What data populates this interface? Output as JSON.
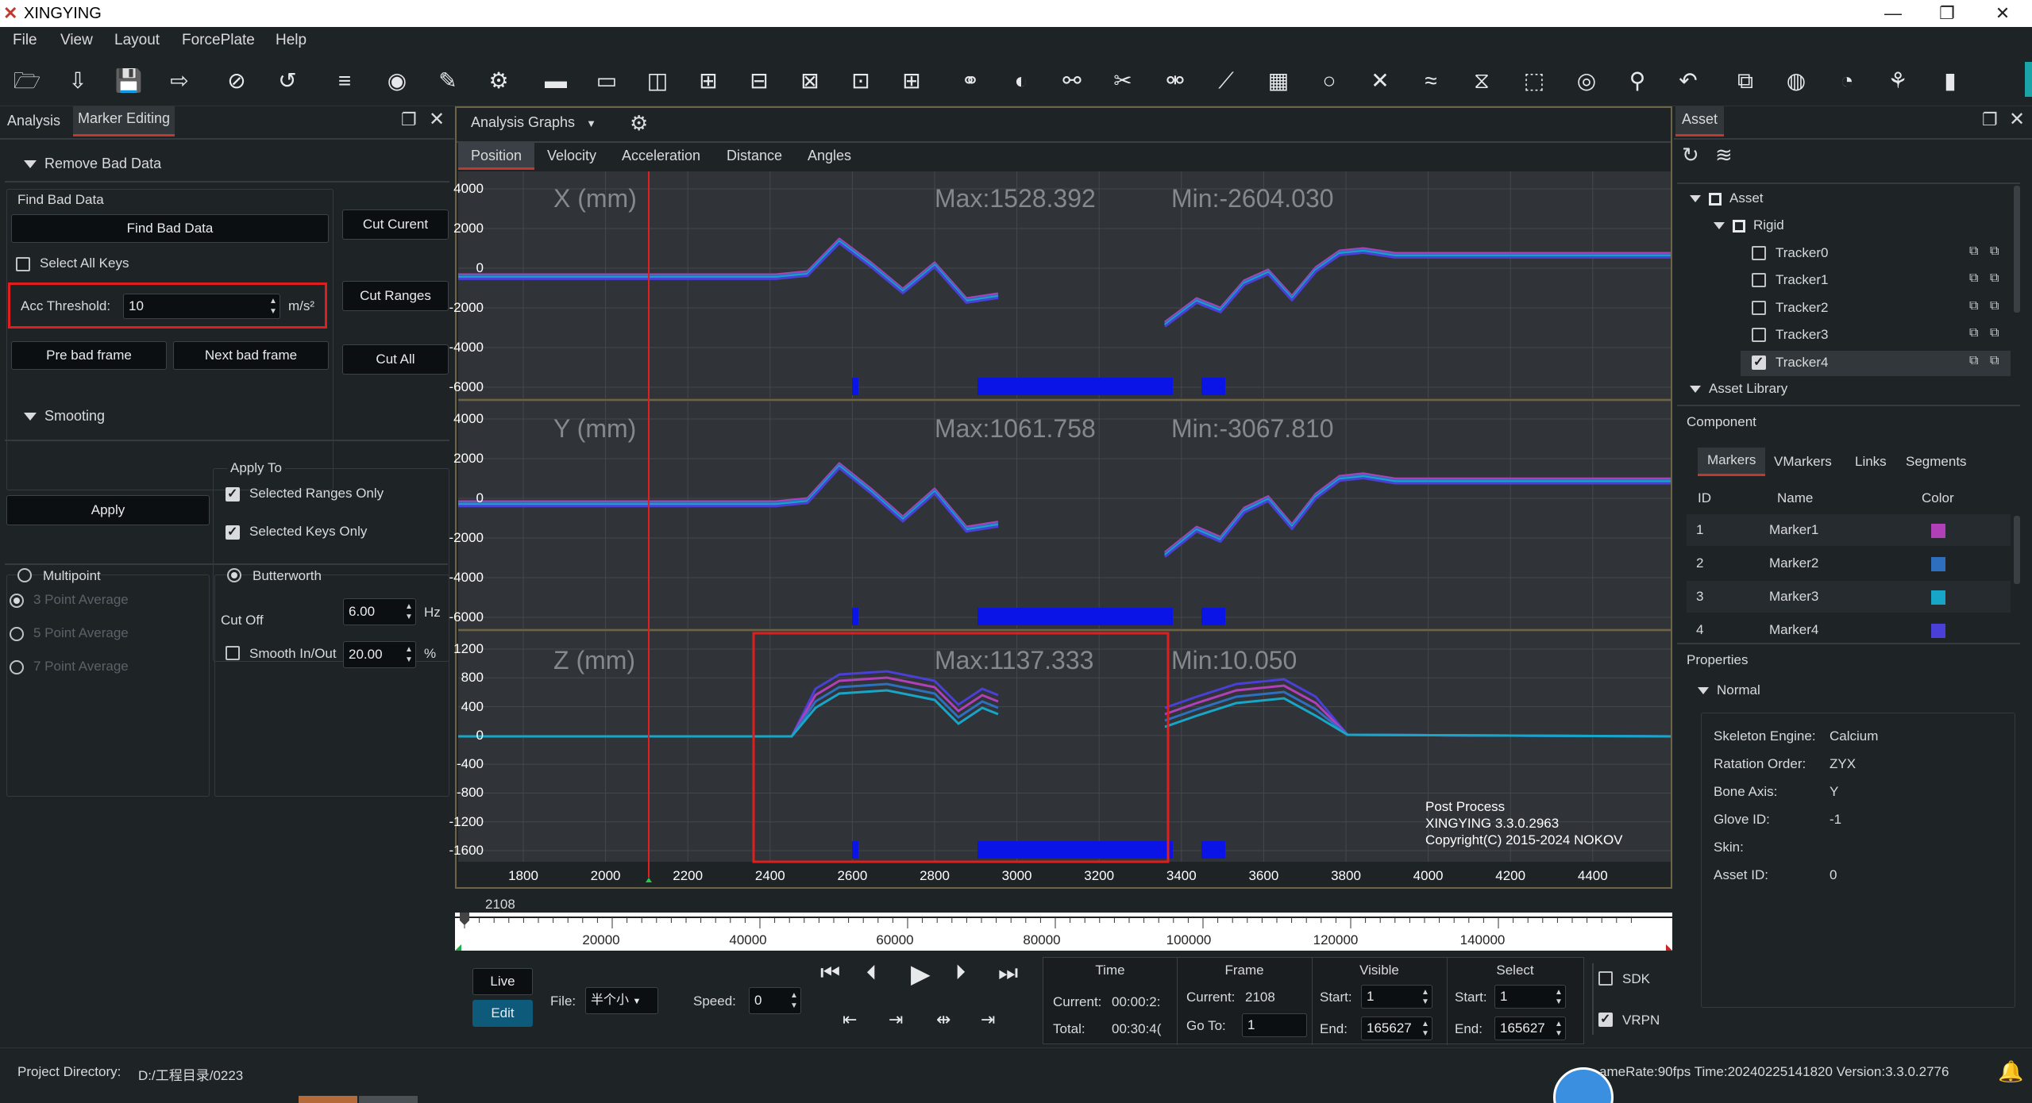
{
  "app": {
    "title": "XINGYING"
  },
  "window_controls": [
    "—",
    "❐",
    "✕"
  ],
  "menu": [
    "File",
    "View",
    "Layout",
    "ForcePlate",
    "Help"
  ],
  "toolbar_icons": [
    "open-folder-icon",
    "import-icon",
    "save-icon",
    "export-icon",
    "hide-icon",
    "rotate-icon",
    "layers-icon",
    "capture-icon",
    "edit-icon",
    "settings-icon",
    "layout-1-icon",
    "layout-2-icon",
    "layout-3-icon",
    "layout-4-icon",
    "layout-5-icon",
    "layout-6-icon",
    "layout-7-icon",
    "layout-8-icon",
    "link-icon",
    "fill-icon",
    "merge-icon",
    "cut-icon",
    "connect-icon",
    "bone-icon",
    "calculator-icon",
    "search-icon",
    "remove-icon",
    "smooth-icon",
    "trim-icon",
    "select-icon",
    "reset-icon",
    "run-icon",
    "undo-icon",
    "rigid-icon",
    "3d-icon",
    "speed-icon",
    "skeleton-icon",
    "chart-icon"
  ],
  "left": {
    "tabs": [
      "Analysis",
      "Marker Editing"
    ],
    "remove_bad_data": "Remove Bad Data",
    "find_bad_data": "Find Bad Data",
    "find_bad_data_btn": "Find Bad Data",
    "cut_current": "Cut Curent",
    "cut_ranges": "Cut Ranges",
    "cut_all": "Cut All",
    "select_all_keys": "Select All Keys",
    "acc_threshold_label": "Acc Threshold:",
    "acc_threshold_value": "10",
    "acc_unit": "m/s²",
    "pre_bad_frame": "Pre bad frame",
    "next_bad_frame": "Next bad frame",
    "smooting": "Smooting",
    "apply_to": "Apply To",
    "apply": "Apply",
    "selected_ranges_only": "Selected Ranges Only",
    "selected_keys_only": "Selected Keys Only",
    "multipoint": "Multipoint",
    "butterworth": "Butterworth",
    "avg3": "3 Point Average",
    "avg5": "5 Point Average",
    "avg7": "7 Point Average",
    "cutoff_label": "Cut Off",
    "cutoff_value": "6.00",
    "cutoff_unit": "Hz",
    "smooth_inout": "Smooth In/Out",
    "smooth_value": "20.00",
    "smooth_unit": "%"
  },
  "graphs": {
    "title": "Analysis Graphs",
    "tabs": [
      "Position",
      "Velocity",
      "Acceleration",
      "Distance",
      "Angles"
    ],
    "panels": [
      {
        "label": "X (mm)",
        "max": "Max:1528.392",
        "min": "Min:-2604.030",
        "yticks": [
          "4000",
          "2000",
          "0",
          "-2000",
          "-4000",
          "-6000"
        ]
      },
      {
        "label": "Y (mm)",
        "max": "Max:1061.758",
        "min": "Min:-3067.810",
        "yticks": [
          "4000",
          "2000",
          "0",
          "-2000",
          "-4000",
          "-6000"
        ]
      },
      {
        "label": "Z (mm)",
        "max": "Max:1137.333",
        "min": "Min:10.050",
        "yticks": [
          "1200",
          "800",
          "400",
          "0",
          "-400",
          "-800",
          "-1200",
          "-1600"
        ]
      }
    ],
    "xticks": [
      "1800",
      "2000",
      "2200",
      "2400",
      "2600",
      "2800",
      "3000",
      "3200",
      "3400",
      "3600",
      "3800",
      "4000",
      "4200",
      "4400"
    ],
    "watermark": [
      "Post Process",
      "XINGYING 3.3.0.2963",
      "Copyright(C) 2015-2024 NOKOV"
    ],
    "colors": {
      "marker1": "#b140b8",
      "marker2": "#2f6fc0",
      "marker3": "#18a6c8",
      "marker4": "#4a3fd6",
      "bad_data": "#0a14e6",
      "cursor": "#e02020"
    }
  },
  "timeline": {
    "current_frame": "2108",
    "ticks": [
      "20000",
      "40000",
      "60000",
      "80000",
      "100000",
      "120000",
      "140000"
    ]
  },
  "playback": {
    "live": "Live",
    "edit": "Edit",
    "file_label": "File:",
    "file_value": "半个小",
    "speed_label": "Speed:",
    "speed_value": "0",
    "time_header": "Time",
    "frame_header": "Frame",
    "visible_header": "Visible",
    "select_header": "Select",
    "current_label": "Current:",
    "current_time": "00:00:2:",
    "total_label": "Total:",
    "total_time": "00:30:4(",
    "current_frame_label": "Current:",
    "current_frame": "2108",
    "goto_label": "Go To:",
    "goto_value": "1",
    "start_label": "Start:",
    "visible_start": "1",
    "end_label": "End:",
    "visible_end": "165627",
    "select_start": "1",
    "select_end": "165627",
    "sdk": "SDK",
    "vrpn": "VRPN"
  },
  "status": {
    "project_dir_label": "Project Directory:",
    "project_dir": "D:/工程目录/0223",
    "right": "ameRate:90fps  Time:20240225141820  Version:3.3.0.2776"
  },
  "asset": {
    "tab": "Asset",
    "tree": {
      "root": "Asset",
      "rigid": "Rigid",
      "trackers": [
        "Tracker0",
        "Tracker1",
        "Tracker2",
        "Tracker3",
        "Tracker4"
      ],
      "library": "Asset Library"
    },
    "component": "Component",
    "comp_tabs": [
      "Markers",
      "VMarkers",
      "Links",
      "Segments"
    ],
    "cols": [
      "ID",
      "Name",
      "Color"
    ],
    "markers": [
      {
        "id": "1",
        "name": "Marker1",
        "color": "#b140b8"
      },
      {
        "id": "2",
        "name": "Marker2",
        "color": "#2f6fc0"
      },
      {
        "id": "3",
        "name": "Marker3",
        "color": "#18a6c8"
      },
      {
        "id": "4",
        "name": "Marker4",
        "color": "#4a3fd6"
      }
    ],
    "properties": "Properties",
    "normal": "Normal",
    "props": [
      {
        "k": "Skeleton Engine:",
        "v": "Calcium"
      },
      {
        "k": "Ratation Order:",
        "v": "ZYX"
      },
      {
        "k": "Bone Axis:",
        "v": "Y"
      },
      {
        "k": "Glove ID:",
        "v": "-1"
      },
      {
        "k": "Skin:",
        "v": ""
      },
      {
        "k": "Asset ID:",
        "v": "0"
      }
    ]
  }
}
